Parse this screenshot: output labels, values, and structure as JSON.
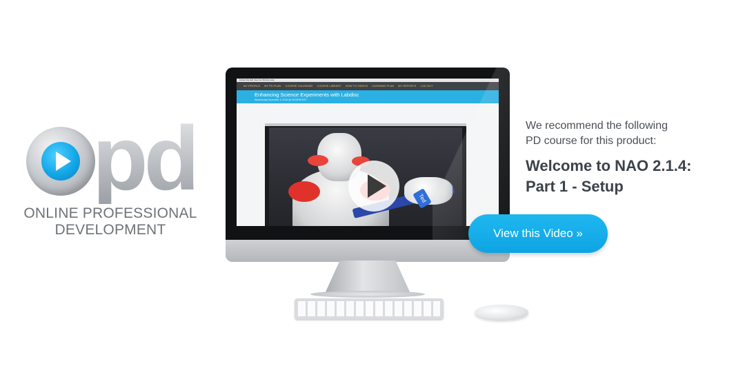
{
  "logo": {
    "letters": "pd",
    "text_line1": "ONLINE PROFESSIONAL",
    "text_line2": "DEVELOPMENT"
  },
  "screen": {
    "menubar": "Finder  File  Edit  View  Go  Window  Help",
    "nav_items": [
      "MY PROFILE",
      "MY PD PLAN",
      "COURSE CALENDAR",
      "COURSE LIBRARY",
      "HOW TO VIDEOS",
      "LEARNING PLAN",
      "MY REPORTS",
      "LOG OUT"
    ],
    "course_title": "Enhancing Science Experiments with Labdisc",
    "course_date": "Wednesday November 4, 2015 @ 04:00PM EST",
    "video_tag": "Ted"
  },
  "promo": {
    "recommend_line1": "We recommend the following",
    "recommend_line2": "PD course for this product:",
    "course_line1": "Welcome to NAO 2.1.4:",
    "course_line2": "Part 1 - Setup",
    "button_label": "View this Video »"
  },
  "colors": {
    "accent": "#0ea4e4",
    "heading": "#3c4249",
    "body_text": "#4a4f55",
    "logo_gray": "#b8bcc1",
    "banner_cyan": "#2bb0e3"
  }
}
